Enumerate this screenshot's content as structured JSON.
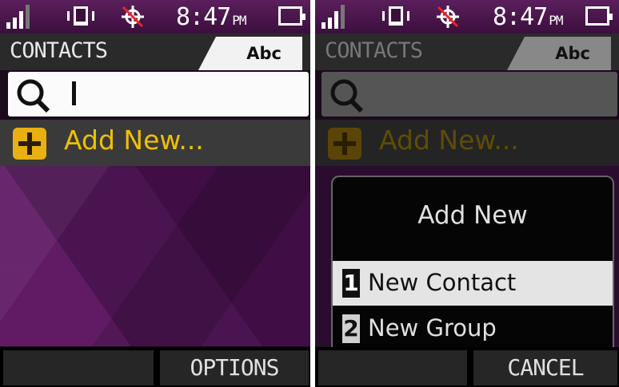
{
  "left": {
    "status": {
      "time": "8:47",
      "ampm": "PM"
    },
    "header": {
      "title": "CONTACTS",
      "tab_label": "Abc"
    },
    "search": {
      "value": ""
    },
    "add_new_label": "Add New...",
    "softkeys": {
      "left": "",
      "right": "OPTIONS"
    }
  },
  "right": {
    "status": {
      "time": "8:47",
      "ampm": "PM"
    },
    "header": {
      "title": "CONTACTS",
      "tab_label": "Abc"
    },
    "add_new_label": "Add New...",
    "popup": {
      "title": "Add New",
      "options": [
        {
          "num": "1",
          "label": "New Contact",
          "selected": true
        },
        {
          "num": "2",
          "label": "New Group",
          "selected": false
        }
      ]
    },
    "softkeys": {
      "left": "",
      "right": "CANCEL"
    }
  },
  "colors": {
    "accent": "#f0c000",
    "plus_bg": "#e8b010",
    "wallpaper": "#4a1450"
  }
}
